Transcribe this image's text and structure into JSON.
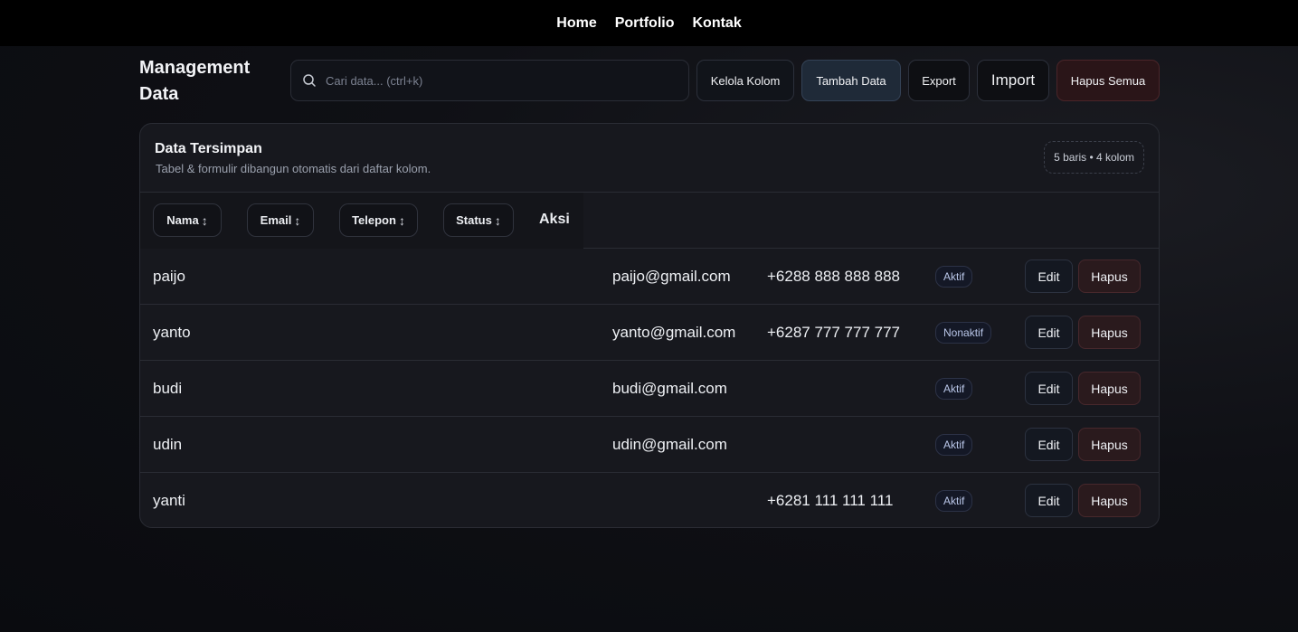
{
  "nav": {
    "items": [
      "Home",
      "Portfolio",
      "Kontak"
    ]
  },
  "page": {
    "title": "Management Data"
  },
  "search": {
    "placeholder": "Cari data... (ctrl+k)"
  },
  "toolbar": {
    "kelola_kolom": "Kelola Kolom",
    "tambah_data": "Tambah Data",
    "export": "Export",
    "import": "Import",
    "hapus_semua": "Hapus Semua"
  },
  "card": {
    "title": "Data Tersimpan",
    "subtitle": "Tabel & formulir dibangun otomatis dari daftar kolom.",
    "count": "5 baris • 4 kolom"
  },
  "table": {
    "sort_glyph": "↕",
    "columns": [
      "Nama",
      "Email",
      "Telepon",
      "Status"
    ],
    "aksi_label": "Aksi",
    "edit_label": "Edit",
    "hapus_label": "Hapus",
    "rows": [
      {
        "nama": "paijo",
        "email": "paijo@gmail.com",
        "telepon": "+6288 888 888 888",
        "status": "Aktif"
      },
      {
        "nama": "yanto",
        "email": "yanto@gmail.com",
        "telepon": "+6287 777 777 777",
        "status": "Nonaktif"
      },
      {
        "nama": "budi",
        "email": "budi@gmail.com",
        "telepon": "",
        "status": "Aktif"
      },
      {
        "nama": "udin",
        "email": "udin@gmail.com",
        "telepon": "",
        "status": "Aktif"
      },
      {
        "nama": "yanti",
        "email": "",
        "telepon": "+6281 111 111 111",
        "status": "Aktif"
      }
    ]
  },
  "icons": {
    "search": "search-icon"
  }
}
